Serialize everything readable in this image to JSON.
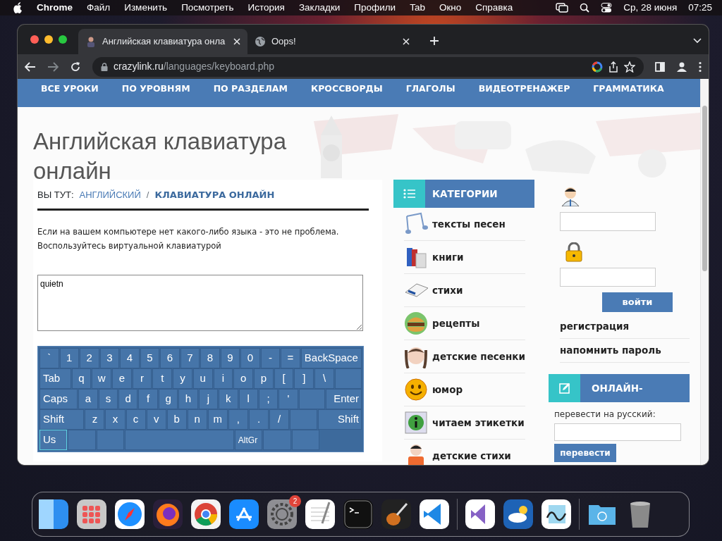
{
  "menubar": {
    "app": "Chrome",
    "menus": [
      "Файл",
      "Изменить",
      "Посмотреть",
      "История",
      "Закладки",
      "Профили",
      "Tab",
      "Окно",
      "Справка"
    ],
    "date": "Ср, 28 июня",
    "time": "07:25"
  },
  "browser": {
    "tabs": [
      {
        "title": "Английская клавиатура онла",
        "selected": true
      },
      {
        "title": "Oops!",
        "selected": false
      }
    ],
    "url_host": "crazylink.ru",
    "url_path": "/languages/keyboard.php"
  },
  "site": {
    "nav": [
      "ВСЕ УРОКИ",
      "ПО УРОВНЯМ",
      "ПО РАЗДЕЛАМ",
      "КРОССВОРДЫ",
      "ГЛАГОЛЫ",
      "ВИДЕОТРЕНАЖЕР",
      "ГРАММАТИКА"
    ],
    "title": "Английская клавиатура онлайн",
    "breadcrumb": {
      "label": "ВЫ ТУТ:",
      "parent": "АНГЛИЙСКИЙ",
      "separator": "/",
      "current": "КЛАВИАТУРА ОНЛАЙН"
    },
    "intro": [
      "Если на вашем компьютере нет какого-либо языка - это не проблема.",
      "Воспользуйтесь виртуальной клавиатурой"
    ],
    "input": {
      "value": "quietn"
    },
    "keyboard": {
      "key_rows": [
        [
          {
            "label": "`",
            "kind": "char"
          },
          {
            "label": "1",
            "kind": "char"
          },
          {
            "label": "2",
            "kind": "char"
          },
          {
            "label": "3",
            "kind": "char"
          },
          {
            "label": "4",
            "kind": "char"
          },
          {
            "label": "5",
            "kind": "char"
          },
          {
            "label": "6",
            "kind": "char"
          },
          {
            "label": "7",
            "kind": "char"
          },
          {
            "label": "8",
            "kind": "char"
          },
          {
            "label": "9",
            "kind": "char"
          },
          {
            "label": "0",
            "kind": "char"
          },
          {
            "label": "-",
            "kind": "char"
          },
          {
            "label": "=",
            "kind": "char"
          },
          {
            "label": "BackSpace",
            "kind": "backspace"
          }
        ],
        [
          {
            "label": "Tab",
            "kind": "tab"
          },
          {
            "label": "q",
            "kind": "char"
          },
          {
            "label": "w",
            "kind": "char"
          },
          {
            "label": "e",
            "kind": "char"
          },
          {
            "label": "r",
            "kind": "char"
          },
          {
            "label": "t",
            "kind": "char"
          },
          {
            "label": "y",
            "kind": "char"
          },
          {
            "label": "u",
            "kind": "char"
          },
          {
            "label": "i",
            "kind": "char"
          },
          {
            "label": "o",
            "kind": "char"
          },
          {
            "label": "p",
            "kind": "char"
          },
          {
            "label": "[",
            "kind": "char"
          },
          {
            "label": "]",
            "kind": "char"
          },
          {
            "label": "\\",
            "kind": "char"
          },
          {
            "kind": "blank"
          }
        ],
        [
          {
            "label": "Caps",
            "kind": "caps"
          },
          {
            "label": "a",
            "kind": "char"
          },
          {
            "label": "s",
            "kind": "char"
          },
          {
            "label": "d",
            "kind": "char"
          },
          {
            "label": "f",
            "kind": "char"
          },
          {
            "label": "g",
            "kind": "char"
          },
          {
            "label": "h",
            "kind": "char"
          },
          {
            "label": "j",
            "kind": "char"
          },
          {
            "label": "k",
            "kind": "char"
          },
          {
            "label": "l",
            "kind": "char"
          },
          {
            "label": ";",
            "kind": "char"
          },
          {
            "label": "'",
            "kind": "char"
          },
          {
            "kind": "blank"
          },
          {
            "label": "Enter",
            "kind": "enter"
          }
        ],
        [
          {
            "label": "Shift",
            "kind": "shift"
          },
          {
            "label": "z",
            "kind": "char"
          },
          {
            "label": "x",
            "kind": "char"
          },
          {
            "label": "c",
            "kind": "char"
          },
          {
            "label": "v",
            "kind": "char"
          },
          {
            "label": "b",
            "kind": "char"
          },
          {
            "label": "n",
            "kind": "char"
          },
          {
            "label": "m",
            "kind": "char"
          },
          {
            "label": ",",
            "kind": "char"
          },
          {
            "label": ".",
            "kind": "char"
          },
          {
            "label": "/",
            "kind": "char"
          },
          {
            "kind": "blank"
          },
          {
            "label": "Shift",
            "kind": "shift"
          }
        ],
        [
          {
            "label": "Us",
            "kind": "mod",
            "selected": true
          },
          {
            "kind": "mod",
            "selected": false
          },
          {
            "kind": "mod",
            "selected": false
          },
          {
            "kind": "space",
            "selected": false
          },
          {
            "label": "AltGr",
            "kind": "mod",
            "selected": false
          },
          {
            "kind": "mod",
            "selected": false
          },
          {
            "kind": "mod",
            "selected": false
          }
        ]
      ]
    }
  },
  "categories": {
    "title": "КАТЕГОРИИ",
    "items": [
      {
        "label": "тексты песен",
        "kind": "music"
      },
      {
        "label": "книги",
        "kind": "books"
      },
      {
        "label": "стихи",
        "kind": "book"
      },
      {
        "label": "рецепты",
        "kind": "burger"
      },
      {
        "label": "детские песенки",
        "kind": "girl"
      },
      {
        "label": "юмор",
        "kind": "smiley"
      },
      {
        "label": "читаем этикетки",
        "kind": "info"
      },
      {
        "label": "детские стихи",
        "kind": "child"
      }
    ]
  },
  "login": {
    "button": "войти",
    "links": [
      "регистрация",
      "напомнить пароль"
    ]
  },
  "translator": {
    "title": "ОНЛАЙН-",
    "label": "перевести на русский:",
    "button": "перевести"
  },
  "dock": {
    "badge": "2"
  }
}
